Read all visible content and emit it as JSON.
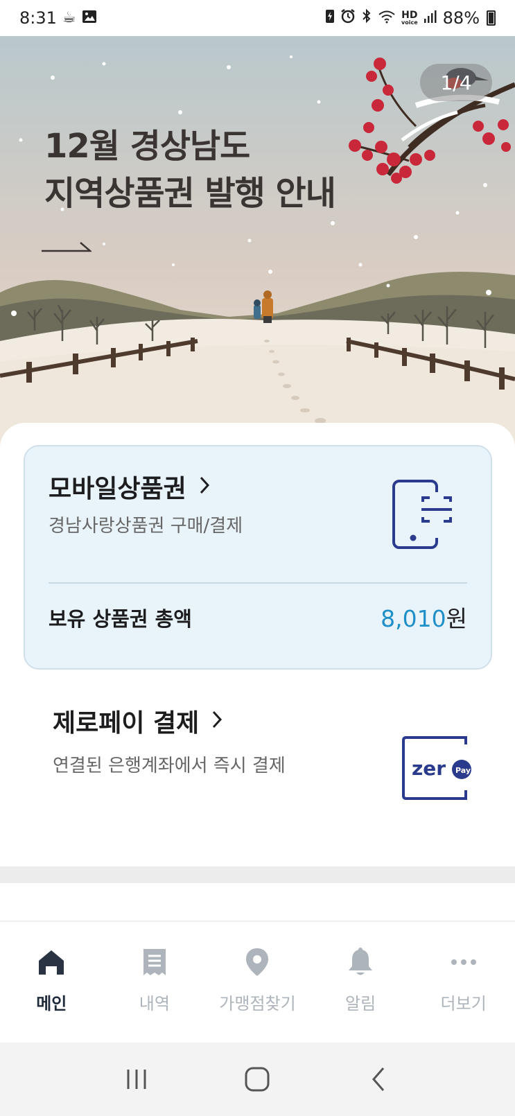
{
  "status_bar": {
    "time": "8:31",
    "battery": "88%",
    "hd_label": "HD",
    "voice_label": "voice"
  },
  "banner": {
    "title_line1": "12월 경상남도",
    "title_line2": "지역상품권 발행 안내",
    "page_indicator": "1/4"
  },
  "voucher_card": {
    "title": "모바일상품권",
    "subtitle": "경남사랑상품권 구매/결제",
    "balance_label": "보유 상품권 총액",
    "balance_amount": "8,010",
    "balance_unit": "원"
  },
  "zeropay": {
    "title": "제로페이 결제",
    "subtitle": "연결된 은행계좌에서 즉시 결제",
    "logo_text": "zer",
    "logo_badge": "Pay"
  },
  "bottom_nav": {
    "items": [
      {
        "label": "메인",
        "icon": "home-icon",
        "active": true
      },
      {
        "label": "내역",
        "icon": "receipt-icon",
        "active": false
      },
      {
        "label": "가맹점찾기",
        "icon": "location-pin-icon",
        "active": false
      },
      {
        "label": "알림",
        "icon": "bell-icon",
        "active": false
      },
      {
        "label": "더보기",
        "icon": "more-icon",
        "active": false
      }
    ]
  },
  "colors": {
    "accent_blue": "#1e8fc8",
    "card_bg": "#e9f4fa",
    "nav_active": "#1f2a3a",
    "nav_inactive": "#aeb4bb",
    "zeropay_navy": "#2a3a8c"
  }
}
